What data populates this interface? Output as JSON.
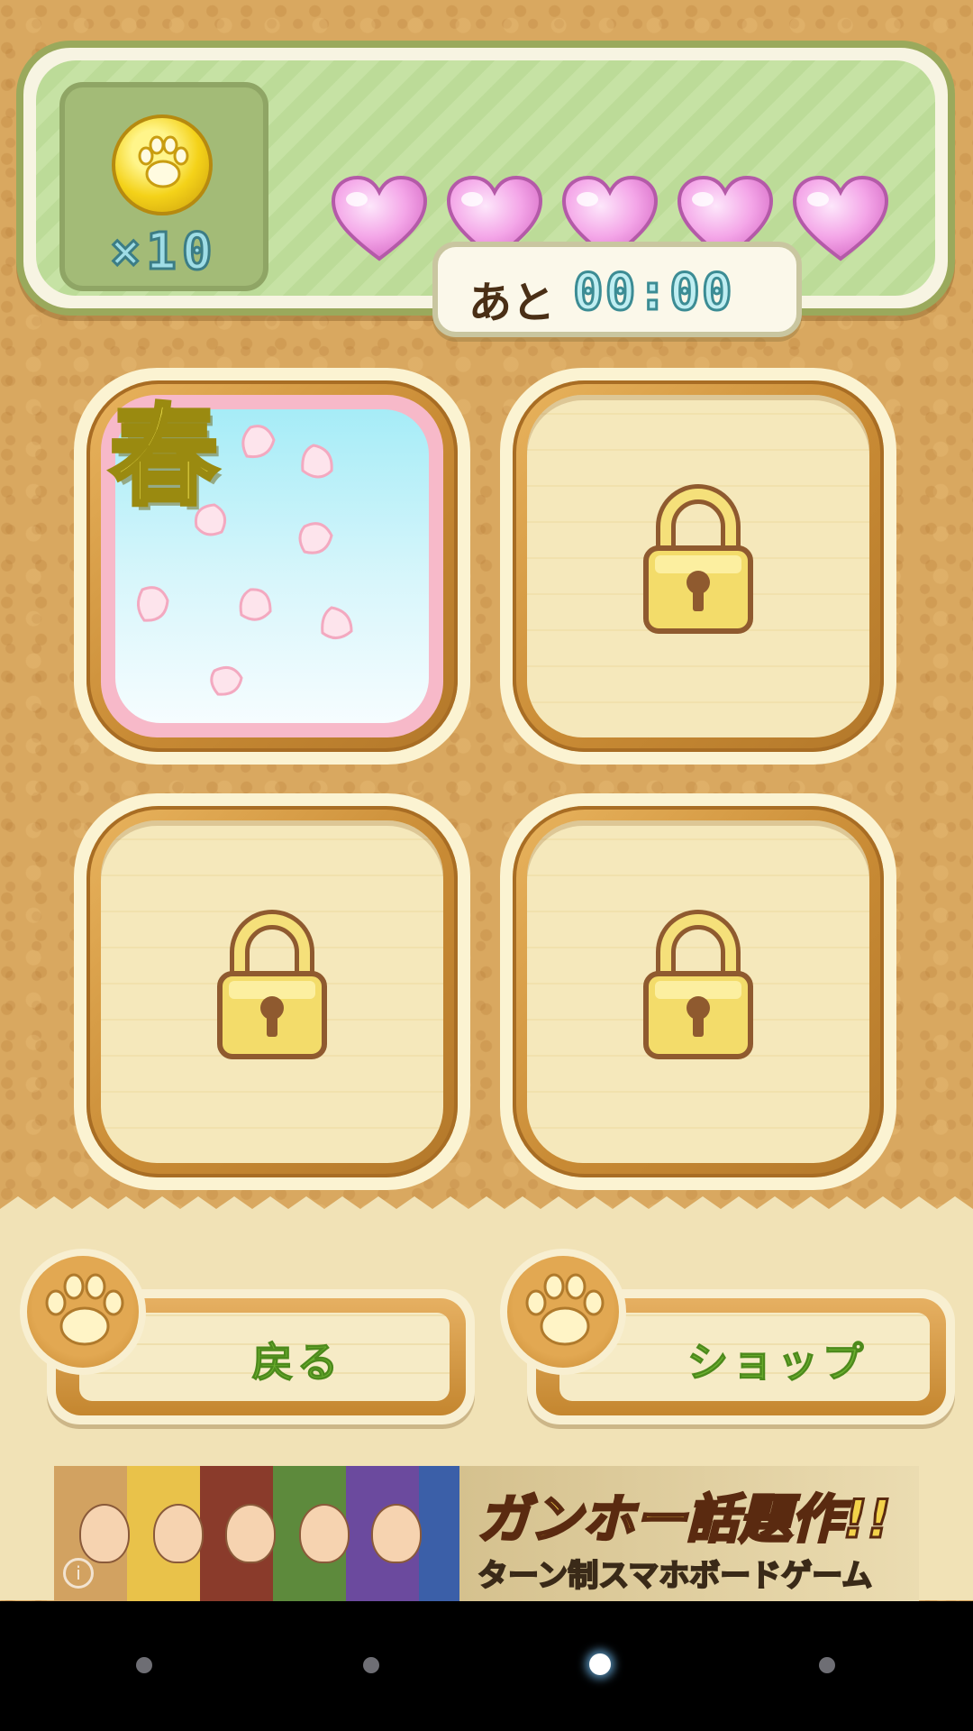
{
  "status": {
    "coin_count": "×10",
    "hearts_filled": 5,
    "hearts_total": 5,
    "timer_label": "あと",
    "timer_value": "00:00"
  },
  "stages": [
    {
      "label": "春",
      "locked": false
    },
    {
      "label": "",
      "locked": true
    },
    {
      "label": "",
      "locked": true
    },
    {
      "label": "",
      "locked": true
    }
  ],
  "buttons": {
    "back_label": "戻る",
    "shop_label": "ショップ"
  },
  "ad": {
    "headline": "ガンホー話題作!!",
    "subline": "ターン制スマホボードゲーム"
  },
  "system_nav": {
    "active_index": 2,
    "count": 4
  },
  "colors": {
    "heart": "#f39ae3",
    "coin": "#f4d219",
    "button_text": "#6cb12f",
    "panel_green": "#c6e2a4"
  }
}
